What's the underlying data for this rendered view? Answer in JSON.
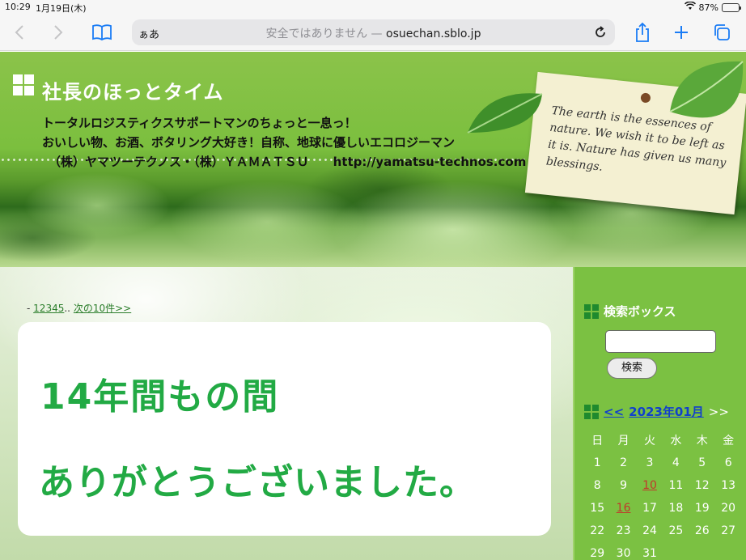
{
  "status_bar": {
    "time": "10:29",
    "date": "1月19日(木)",
    "battery": "87%",
    "battery_level": 0.87
  },
  "browser": {
    "reader_label": "ぁあ",
    "insecure_label": "安全ではありません —",
    "domain": "osuechan.sblo.jp",
    "icons": [
      "back-icon",
      "forward-icon",
      "bookmarks-icon",
      "reload-icon",
      "share-icon",
      "new-tab-icon",
      "tabs-icon"
    ]
  },
  "header": {
    "title": "社長のほっとタイム",
    "desc_line1": "トータルロジスティクスサポートマンのちょっと一息っ！",
    "desc_line2": "おいしい物、お酒、ボタリング大好き！自称、地球に優しいエコロジーマン",
    "desc_line3": "（株）ヤマツーテクノス・（株）ＹＡＭＡＴＳＵ　　http://yamatsu-technos.com",
    "note_text": "The earth is the essences of nature. We wish it to be left as it is. Nature has given us many blessings."
  },
  "pager": {
    "prefix": "- ",
    "pages": [
      "1",
      "2",
      "3",
      "4",
      "5"
    ],
    "ellipsis": "..",
    "next": "次の10件>>"
  },
  "post": {
    "line1": "14年間もの間",
    "line2": "ありがとうございました。"
  },
  "sidebar": {
    "search_title": "検索ボックス",
    "search_button": "検索",
    "calendar": {
      "prev": "<<",
      "month": "2023年01月",
      "next": ">>",
      "weekdays": [
        "日",
        "月",
        "火",
        "水",
        "木",
        "金"
      ],
      "weeks": [
        [
          "1",
          "2",
          "3",
          "4",
          "5",
          "6"
        ],
        [
          "8",
          "9",
          "10",
          "11",
          "12",
          "13"
        ],
        [
          "15",
          "16",
          "17",
          "18",
          "19",
          "20"
        ],
        [
          "22",
          "23",
          "24",
          "25",
          "26",
          "27"
        ],
        [
          "29",
          "30",
          "31",
          "",
          "",
          ""
        ]
      ],
      "linked_days": [
        "10",
        "16"
      ]
    }
  },
  "colors": {
    "accent_green": "#22aa44",
    "sidebar_green": "#7bc142",
    "link_blue": "#1140cc",
    "linked_day_red": "#c0392b"
  }
}
